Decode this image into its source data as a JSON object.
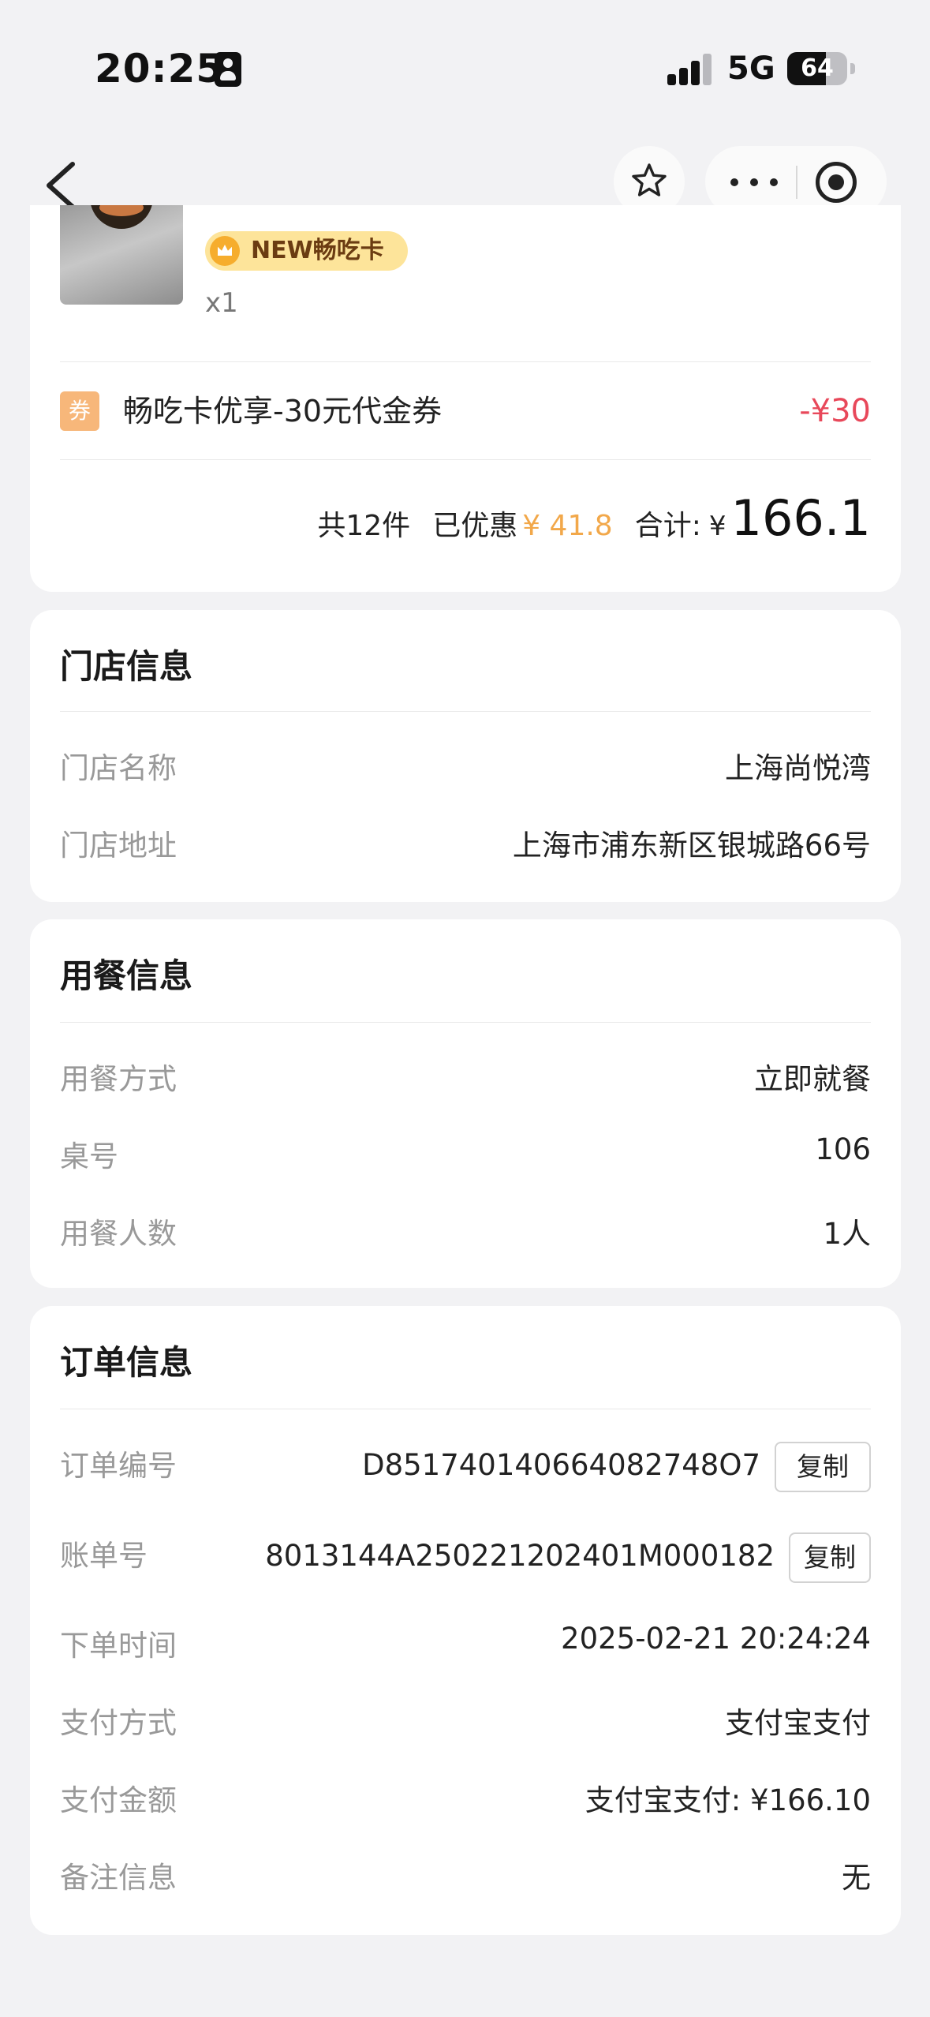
{
  "status_bar": {
    "time": "20:25",
    "network": "5G",
    "battery": "64",
    "battery_level": 0.64
  },
  "nav": {
    "back_icon": "chevron-left-icon",
    "favorite_icon": "star-icon",
    "more_icon": "more-dots-icon",
    "close_icon": "target-circle-icon"
  },
  "order_item": {
    "badge": "NEW畅吃卡",
    "quantity": "x1"
  },
  "coupon": {
    "tag": "券",
    "name": "畅吃卡优享-30元代金券",
    "amount": "-¥30"
  },
  "summary": {
    "count": "共12件",
    "discount_label": "已优惠",
    "discount_value": "¥ 41.8",
    "total_label": "合计:",
    "currency": "¥",
    "total": "166.1"
  },
  "store_info": {
    "title": "门店信息",
    "rows": [
      {
        "label": "门店名称",
        "value": "上海尚悦湾"
      },
      {
        "label": "门店地址",
        "value": "上海市浦东新区银城路66号"
      }
    ]
  },
  "dining_info": {
    "title": "用餐信息",
    "rows": [
      {
        "label": "用餐方式",
        "value": "立即就餐"
      },
      {
        "label": "桌号",
        "value": "106"
      },
      {
        "label": "用餐人数",
        "value": "1人"
      }
    ]
  },
  "order_info": {
    "title": "订单信息",
    "copy_label": "复制",
    "rows": [
      {
        "label": "订单编号",
        "value": "D851740140664082748O7"
      },
      {
        "label": "账单号",
        "value": "8013144A250221202401M000182"
      },
      {
        "label": "下单时间",
        "value": "2025-02-21 20:24:24"
      },
      {
        "label": "支付方式",
        "value": "支付宝支付"
      },
      {
        "label": "支付金额",
        "value": "支付宝支付: ¥166.10"
      },
      {
        "label": "备注信息",
        "value": "无"
      }
    ]
  },
  "colors": {
    "background": "#f2f2f4",
    "discount": "#f2a84a",
    "coupon_amount": "#e8485a",
    "badge_bg": "#fde49a"
  }
}
